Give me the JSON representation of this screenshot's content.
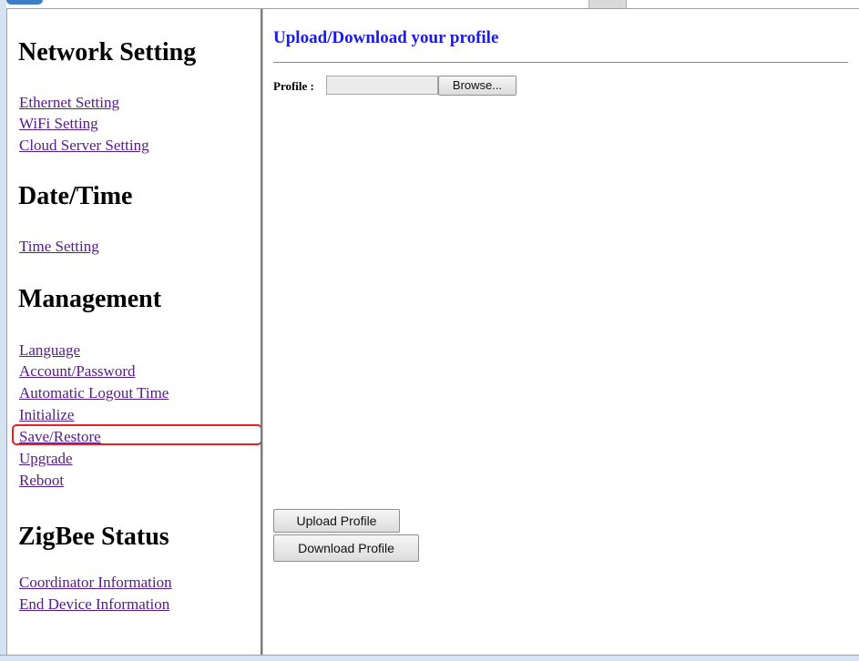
{
  "sidebar": {
    "sections": [
      {
        "title": "Network Setting",
        "links": [
          "Ethernet Setting",
          "WiFi Setting",
          "Cloud Server Setting"
        ]
      },
      {
        "title": "Date/Time",
        "links": [
          "Time Setting"
        ]
      },
      {
        "title": "Management",
        "links": [
          "Language",
          "Account/Password",
          "Automatic Logout Time",
          "Initialize",
          "Save/Restore",
          "Upgrade",
          "Reboot"
        ]
      },
      {
        "title": "ZigBee Status",
        "links": [
          "Coordinator Information",
          "End Device Information"
        ]
      }
    ],
    "highlighted_link": "Save/Restore",
    "highlight_color": "#e52121",
    "link_color": "#551a8b"
  },
  "main": {
    "title": "Upload/Download your profile",
    "title_color": "#1a1aeb",
    "profile_label": "Profile :",
    "file_value": "",
    "browse_label": "Browse...",
    "upload_label": "Upload Profile",
    "download_label": "Download Profile"
  }
}
